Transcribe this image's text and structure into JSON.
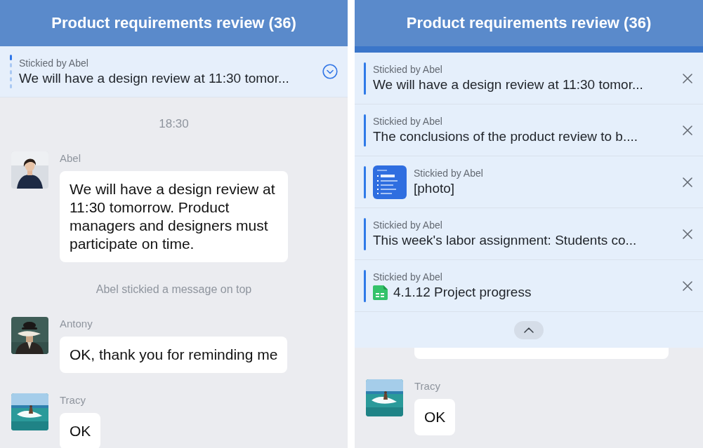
{
  "screens": [
    {
      "kind": "collapsed",
      "title": "Product requirements review (36)",
      "pinned_bar": {
        "label": "Stickied by Abel",
        "text": "We will have a design review at 11:30 tomor..."
      },
      "messages": [
        {
          "kind": "time",
          "text": "18:30"
        },
        {
          "kind": "message",
          "sender": "Abel",
          "text": "We will have a design review at 11:30 tomorrow. Product managers and designers must participate on time."
        },
        {
          "kind": "system",
          "text": "Abel stickied a message on top"
        },
        {
          "kind": "message",
          "sender": "Antony",
          "text": "OK, thank you for reminding me"
        },
        {
          "kind": "message",
          "sender": "Tracy",
          "text": "OK"
        }
      ]
    },
    {
      "kind": "expanded",
      "title": "Product requirements review (36)",
      "pinned": [
        {
          "kind": "text",
          "label": "Stickied by Abel",
          "text": "We will have a design review at 11:30 tomor..."
        },
        {
          "kind": "text",
          "label": "Stickied by Abel",
          "text": "The conclusions of the product review to b...."
        },
        {
          "label": "Stickied by Abel",
          "text": "[photo]"
        },
        {
          "kind": "text",
          "label": "Stickied by Abel",
          "text": "This week's labor assignment: Students co..."
        },
        {
          "kind": "sheet",
          "label": "Stickied by Abel",
          "text": "4.1.12 Project progress"
        }
      ],
      "messages": [
        {
          "kind": "cut"
        },
        {
          "kind": "message",
          "sender": "Tracy",
          "text": "OK"
        }
      ]
    }
  ]
}
